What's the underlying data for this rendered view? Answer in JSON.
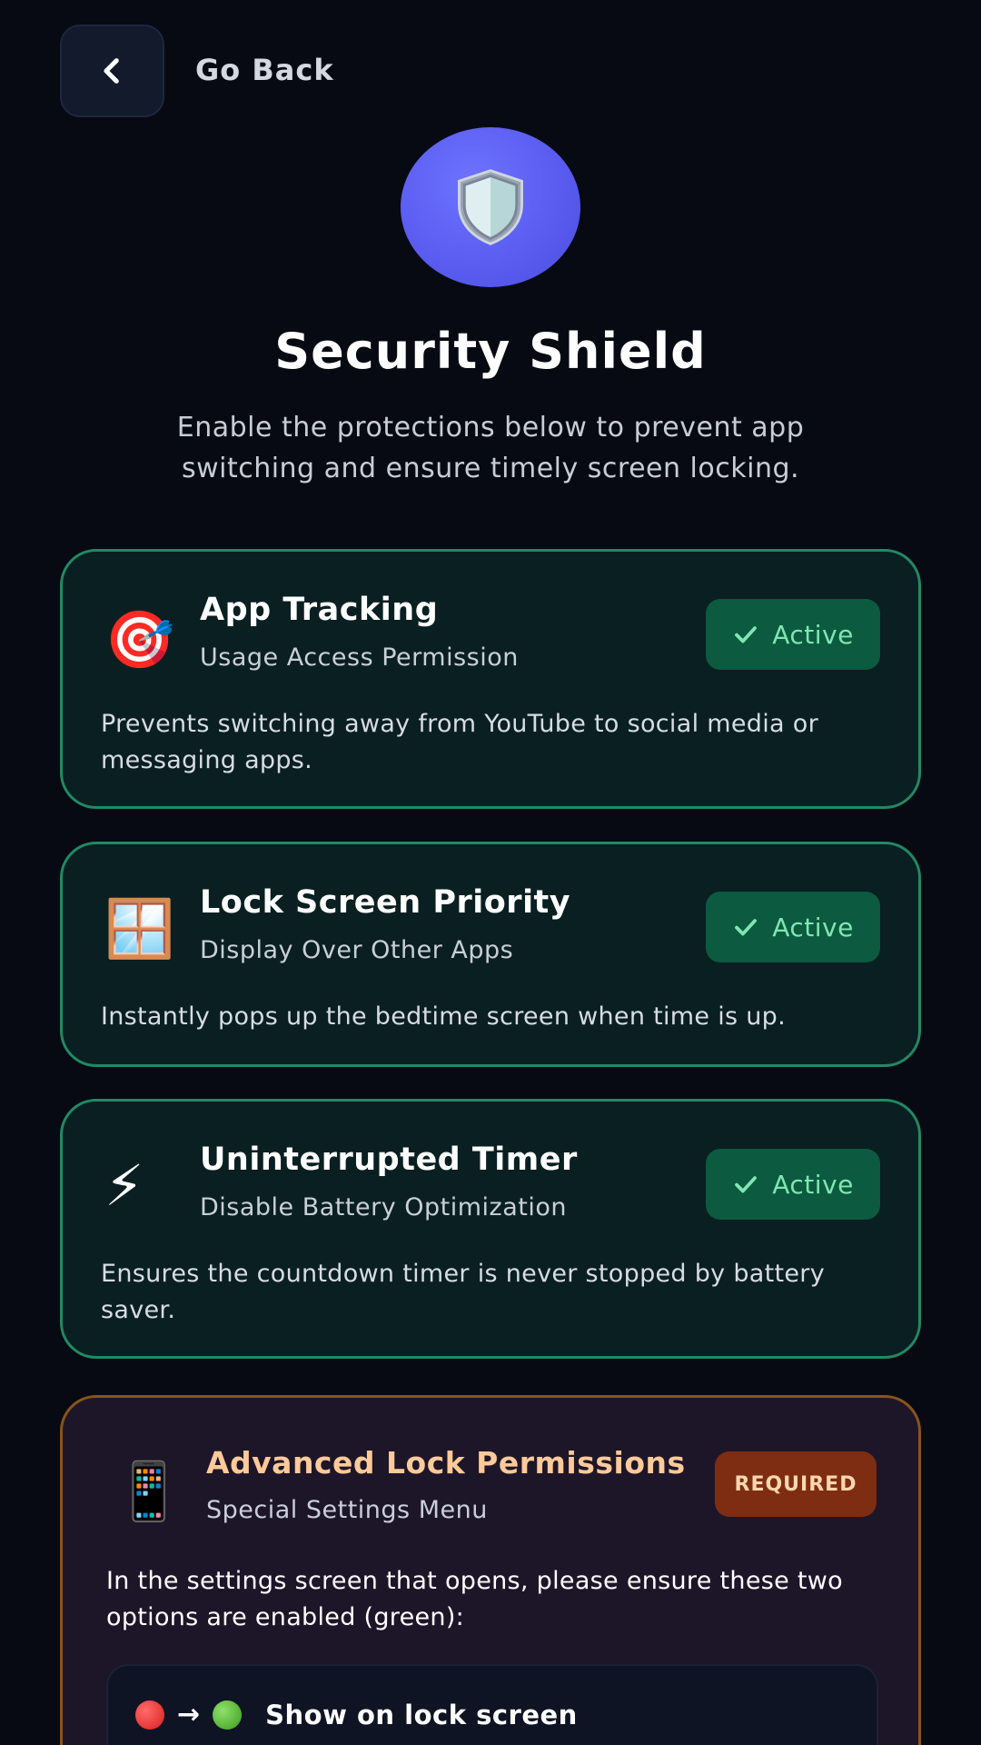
{
  "header": {
    "back_label": "Go Back"
  },
  "hero": {
    "icon": "shield-icon",
    "title": "Security Shield",
    "subtitle": "Enable the protections below to prevent app switching and ensure timely screen locking."
  },
  "cards": [
    {
      "emoji": "🎯",
      "title": "App Tracking",
      "subtitle": "Usage Access Permission",
      "status": "Active",
      "description": "Prevents switching away from YouTube to social media or messaging apps."
    },
    {
      "emoji": "🪟",
      "title": "Lock Screen Priority",
      "subtitle": "Display Over Other Apps",
      "status": "Active",
      "description": "Instantly pops up the bedtime screen when time is up."
    },
    {
      "emoji": "⚡",
      "title": "Uninterrupted Timer",
      "subtitle": "Disable Battery Optimization",
      "status": "Active",
      "description": "Ensures the countdown timer is never stopped by battery saver."
    }
  ],
  "advanced": {
    "emoji": "📱",
    "title": "Advanced Lock Permissions",
    "subtitle": "Special Settings Menu",
    "badge": "REQUIRED",
    "description": "In the settings screen that opens, please ensure these two options are enabled (green):",
    "options": [
      {
        "label": "Show on lock screen"
      }
    ]
  },
  "colors": {
    "background": "#070a12",
    "accent": "#5a5df0",
    "active_border": "#1f8a63",
    "active_badge_bg": "#0c5a3f",
    "active_badge_text": "#7fe7b2",
    "required_border": "#8a5418",
    "required_badge_bg": "#7e2d12",
    "required_title": "#ffc99a"
  }
}
